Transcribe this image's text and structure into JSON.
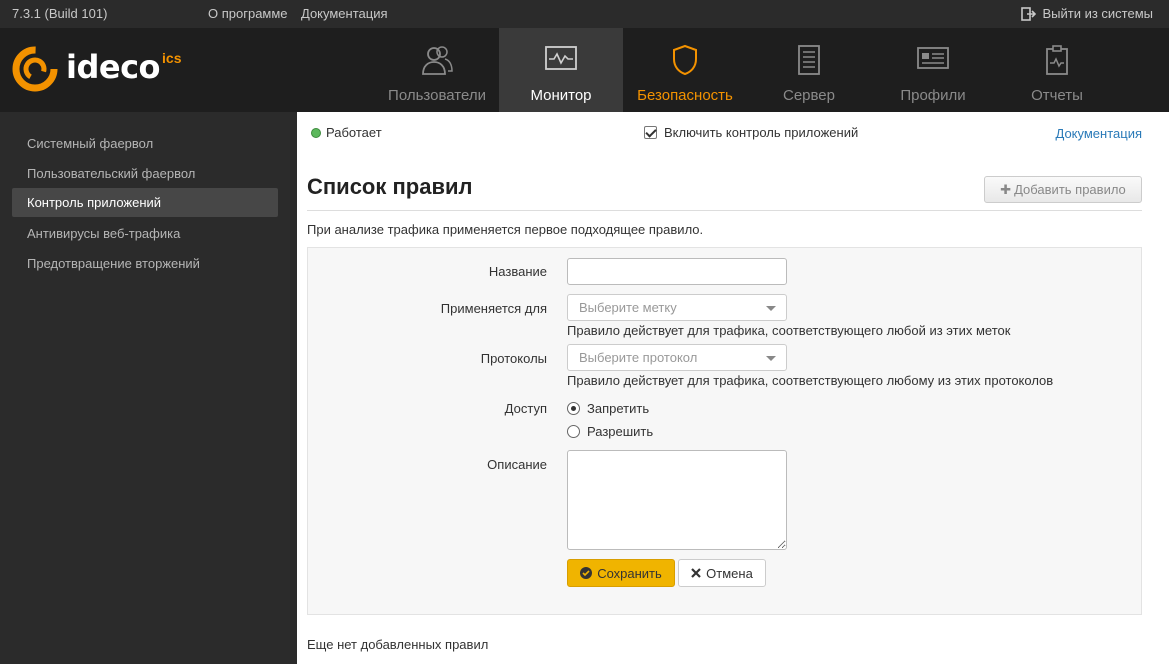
{
  "topbar": {
    "version": "7.3.1 (Build 101)",
    "about": "О программе",
    "docs": "Документация",
    "logout": "Выйти из системы"
  },
  "logo": {
    "word": "ideco",
    "suffix": "ics"
  },
  "nav": [
    {
      "label": "Пользователи",
      "icon": "users-icon"
    },
    {
      "label": "Монитор",
      "icon": "monitor-icon"
    },
    {
      "label": "Безопасность",
      "icon": "shield-icon"
    },
    {
      "label": "Сервер",
      "icon": "server-icon"
    },
    {
      "label": "Профили",
      "icon": "profile-card-icon"
    },
    {
      "label": "Отчеты",
      "icon": "clipboard-icon"
    }
  ],
  "sidebar": {
    "items": [
      {
        "label": "Системный фаервол"
      },
      {
        "label": "Пользовательский фаервол"
      },
      {
        "label": "Контроль приложений"
      },
      {
        "label": "Антивирусы веб-трафика"
      },
      {
        "label": "Предотвращение вторжений"
      }
    ]
  },
  "main": {
    "status": "Работает",
    "enable_label": "Включить контроль приложений",
    "doc_link": "Документация",
    "title": "Список правил",
    "add_rule": "Добавить правило",
    "hint": "При анализе трафика применяется первое подходящее правило.",
    "empty": "Еще нет добавленных правил"
  },
  "form": {
    "name_label": "Название",
    "name_value": "",
    "applies_label": "Применяется для",
    "applies_placeholder": "Выберите метку",
    "applies_help": "Правило действует для трафика, соответствующего любой из этих меток",
    "protocols_label": "Протоколы",
    "protocols_placeholder": "Выберите протокол",
    "protocols_help": "Правило действует для трафика, соответствующего любому из этих протоколов",
    "access_label": "Доступ",
    "access_deny": "Запретить",
    "access_allow": "Разрешить",
    "description_label": "Описание",
    "save": "Сохранить",
    "cancel": "Отмена"
  },
  "colors": {
    "accent": "#f39200",
    "save_button": "#f0b400",
    "link": "#2a7ab8",
    "status_ok": "#5cb85c"
  }
}
